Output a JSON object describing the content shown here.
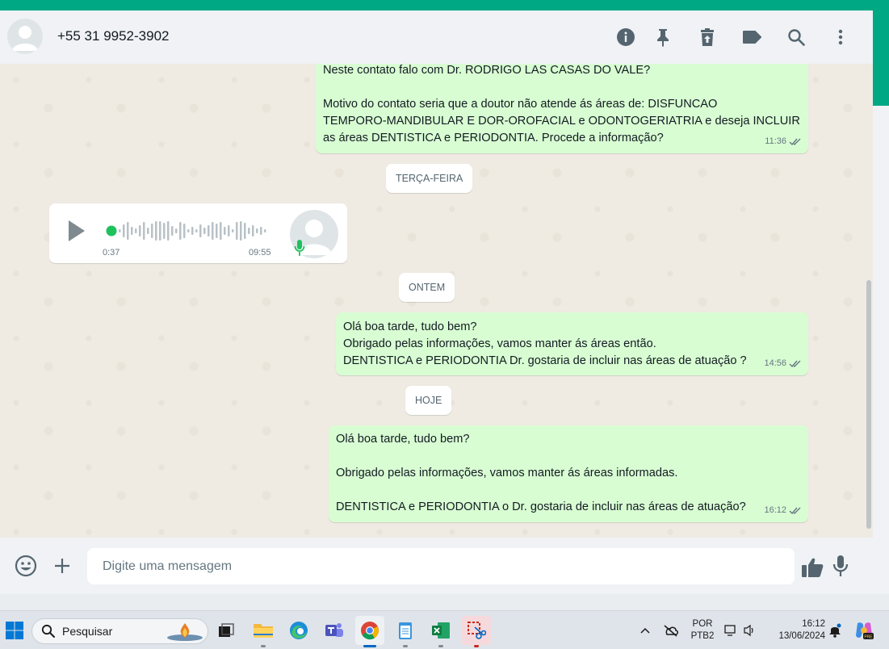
{
  "header": {
    "contact_name": "+55 31 9952-3902",
    "icons": [
      "info-icon",
      "pin-icon",
      "delete-icon",
      "label-icon",
      "search-icon",
      "menu-icon"
    ]
  },
  "messages": [
    {
      "type": "outgoing",
      "text": "Neste contato falo com Dr. RODRIGO LAS CASAS DO VALE?\n\nMotivo do contato seria que a doutor não atende ás áreas de: DISFUNCAO\nTEMPORO-MANDIBULAR E DOR-OROFACIAL e ODONTOGERIATRIA e deseja INCLUIR\nas áreas DENTISTICA e PERIODONTIA. Procede a informação?",
      "time": "11:36"
    },
    {
      "type": "date",
      "label": "TERÇA-FEIRA"
    },
    {
      "type": "voice-incoming",
      "elapsed": "0:37",
      "time": "09:55",
      "progress": 0.0
    },
    {
      "type": "date",
      "label": "ONTEM"
    },
    {
      "type": "outgoing",
      "text": "Olá boa tarde, tudo bem?\nObrigado pelas informações, vamos manter ás áreas então.\nDENTISTICA e PERIODONTIA Dr. gostaria de incluir nas áreas de atuação ?",
      "time": "14:56"
    },
    {
      "type": "date",
      "label": "HOJE"
    },
    {
      "type": "outgoing",
      "text": "Olá boa tarde, tudo bem?\n\nObrigado pelas informações, vamos manter ás áreas informadas.\n\nDENTISTICA e PERIODONTIA o Dr. gostaria de incluir nas áreas de atuação?",
      "time": "16:12"
    }
  ],
  "composer": {
    "placeholder": "Digite uma mensagem",
    "value": ""
  },
  "taskbar": {
    "search_placeholder": "Pesquisar",
    "lang_top": "POR",
    "lang_bottom": "PTB2",
    "clock_time": "16:12",
    "clock_date": "13/06/2024",
    "apps": [
      "windows-start-icon",
      "task-view-icon",
      "file-explorer-icon",
      "edge-icon",
      "teams-icon",
      "chrome-icon",
      "notepad-icon",
      "excel-icon",
      "snipping-tool-icon"
    ]
  },
  "colors": {
    "accent": "#00a884",
    "outgoing_bubble": "#d9fdd3",
    "chat_bg": "#efeae2",
    "voice_green": "#1fc15d"
  }
}
